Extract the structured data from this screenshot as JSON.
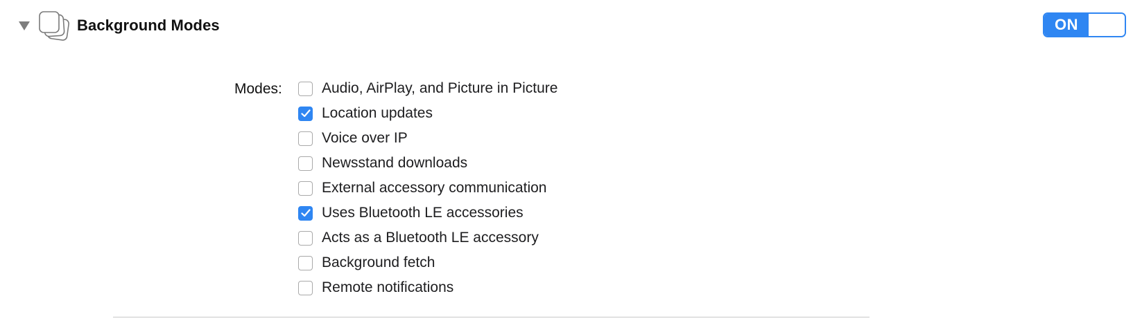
{
  "section": {
    "title": "Background Modes",
    "disclosure_icon": "triangle-down-icon",
    "capability_icon": "stacked-windows-icon"
  },
  "toggle": {
    "label": "ON",
    "state": "on",
    "accent_color": "#2f86f2"
  },
  "modes": {
    "label": "Modes:",
    "items": [
      {
        "label": "Audio, AirPlay, and Picture in Picture",
        "checked": false
      },
      {
        "label": "Location updates",
        "checked": true
      },
      {
        "label": "Voice over IP",
        "checked": false
      },
      {
        "label": "Newsstand downloads",
        "checked": false
      },
      {
        "label": "External accessory communication",
        "checked": false
      },
      {
        "label": "Uses Bluetooth LE accessories",
        "checked": true
      },
      {
        "label": "Acts as a Bluetooth LE accessory",
        "checked": false
      },
      {
        "label": "Background fetch",
        "checked": false
      },
      {
        "label": "Remote notifications",
        "checked": false
      }
    ]
  }
}
